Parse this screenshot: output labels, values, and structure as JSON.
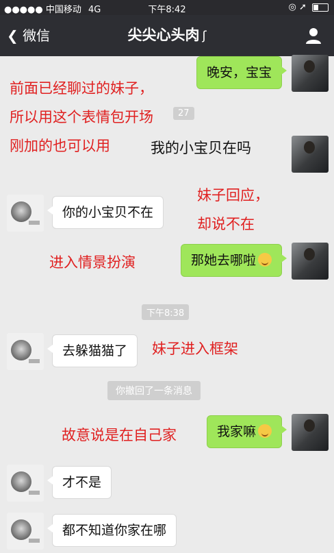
{
  "status": {
    "carrier": "●●●●● 中国移动",
    "network": "4G",
    "time": "下午8:42",
    "right_icons": "◎ ➚"
  },
  "nav": {
    "back": "微信",
    "title": "尖尖心头肉"
  },
  "messages": {
    "m1": "晚安，宝宝",
    "m2": "我的小宝贝在吗",
    "m3": "你的小宝贝不在",
    "m4": "那她去哪啦",
    "ts1": "下午8:38",
    "m5": "去躲猫猫了",
    "sys1": "你撤回了一条消息",
    "m6": "我家嘛",
    "m7": "才不是",
    "m8": "都不知道你家在哪"
  },
  "annotations": {
    "a1": "前面已经聊过的妹子，",
    "a2": "所以用这个表情包开场",
    "a3": "刚加的也可以用",
    "a4": "妹子回应，",
    "a5": "却说不在",
    "a6": "进入情景扮演",
    "a7": "妹子进入框架",
    "a8": "故意说是在自己家"
  },
  "partial_timestamp": "27",
  "colors": {
    "me_bubble": "#9fe65a",
    "annotation": "#e02020",
    "navbar": "#2d2e33"
  }
}
